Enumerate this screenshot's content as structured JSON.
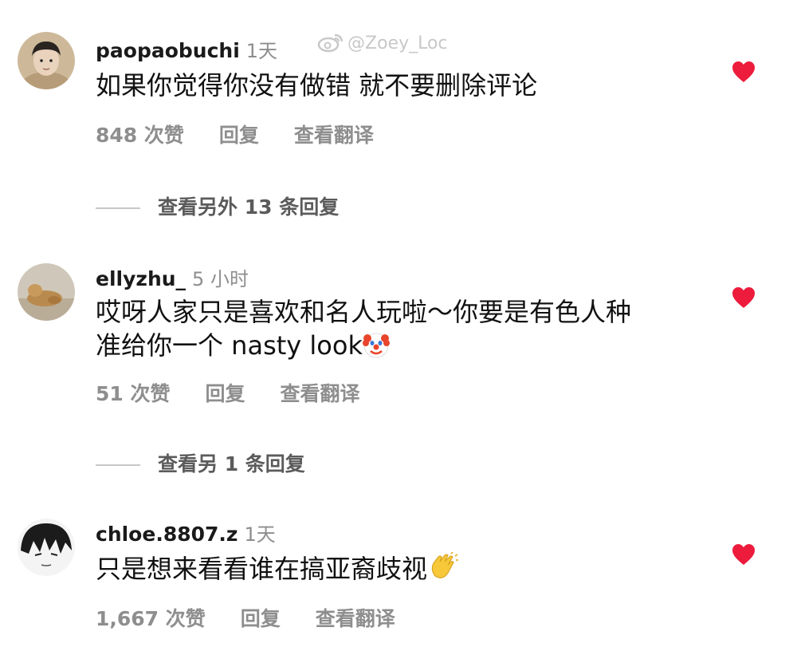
{
  "watermark": "@Zoey_Loc",
  "comments": [
    {
      "username": "paopaobuchi",
      "time": "1天",
      "text": "如果你觉得你没有做错 就不要删除评论",
      "likes": "848 次赞",
      "reply": "回复",
      "translate": "查看翻译",
      "more_replies": "查看另外 13 条回复",
      "liked": true
    },
    {
      "username": "ellyzhu_",
      "time": "5 小时",
      "text_line1": "哎呀人家只是喜欢和名人玩啦～你要是有色人种",
      "text_line2": "准给你一个 nasty look",
      "emoji": "clown-face",
      "likes": "51 次赞",
      "reply": "回复",
      "translate": "查看翻译",
      "more_replies": "查看另 1 条回复",
      "liked": true
    },
    {
      "username": "chloe.8807.z",
      "time": "1天",
      "text": "只是想来看看谁在搞亚裔歧视",
      "emoji": "clapping-hands",
      "likes": "1,667 次赞",
      "reply": "回复",
      "translate": "查看翻译",
      "liked": true
    }
  ],
  "colors": {
    "heart": "#ed1c3c",
    "secondary_text": "#8e8e8e",
    "divider": "#c7c7c7"
  }
}
